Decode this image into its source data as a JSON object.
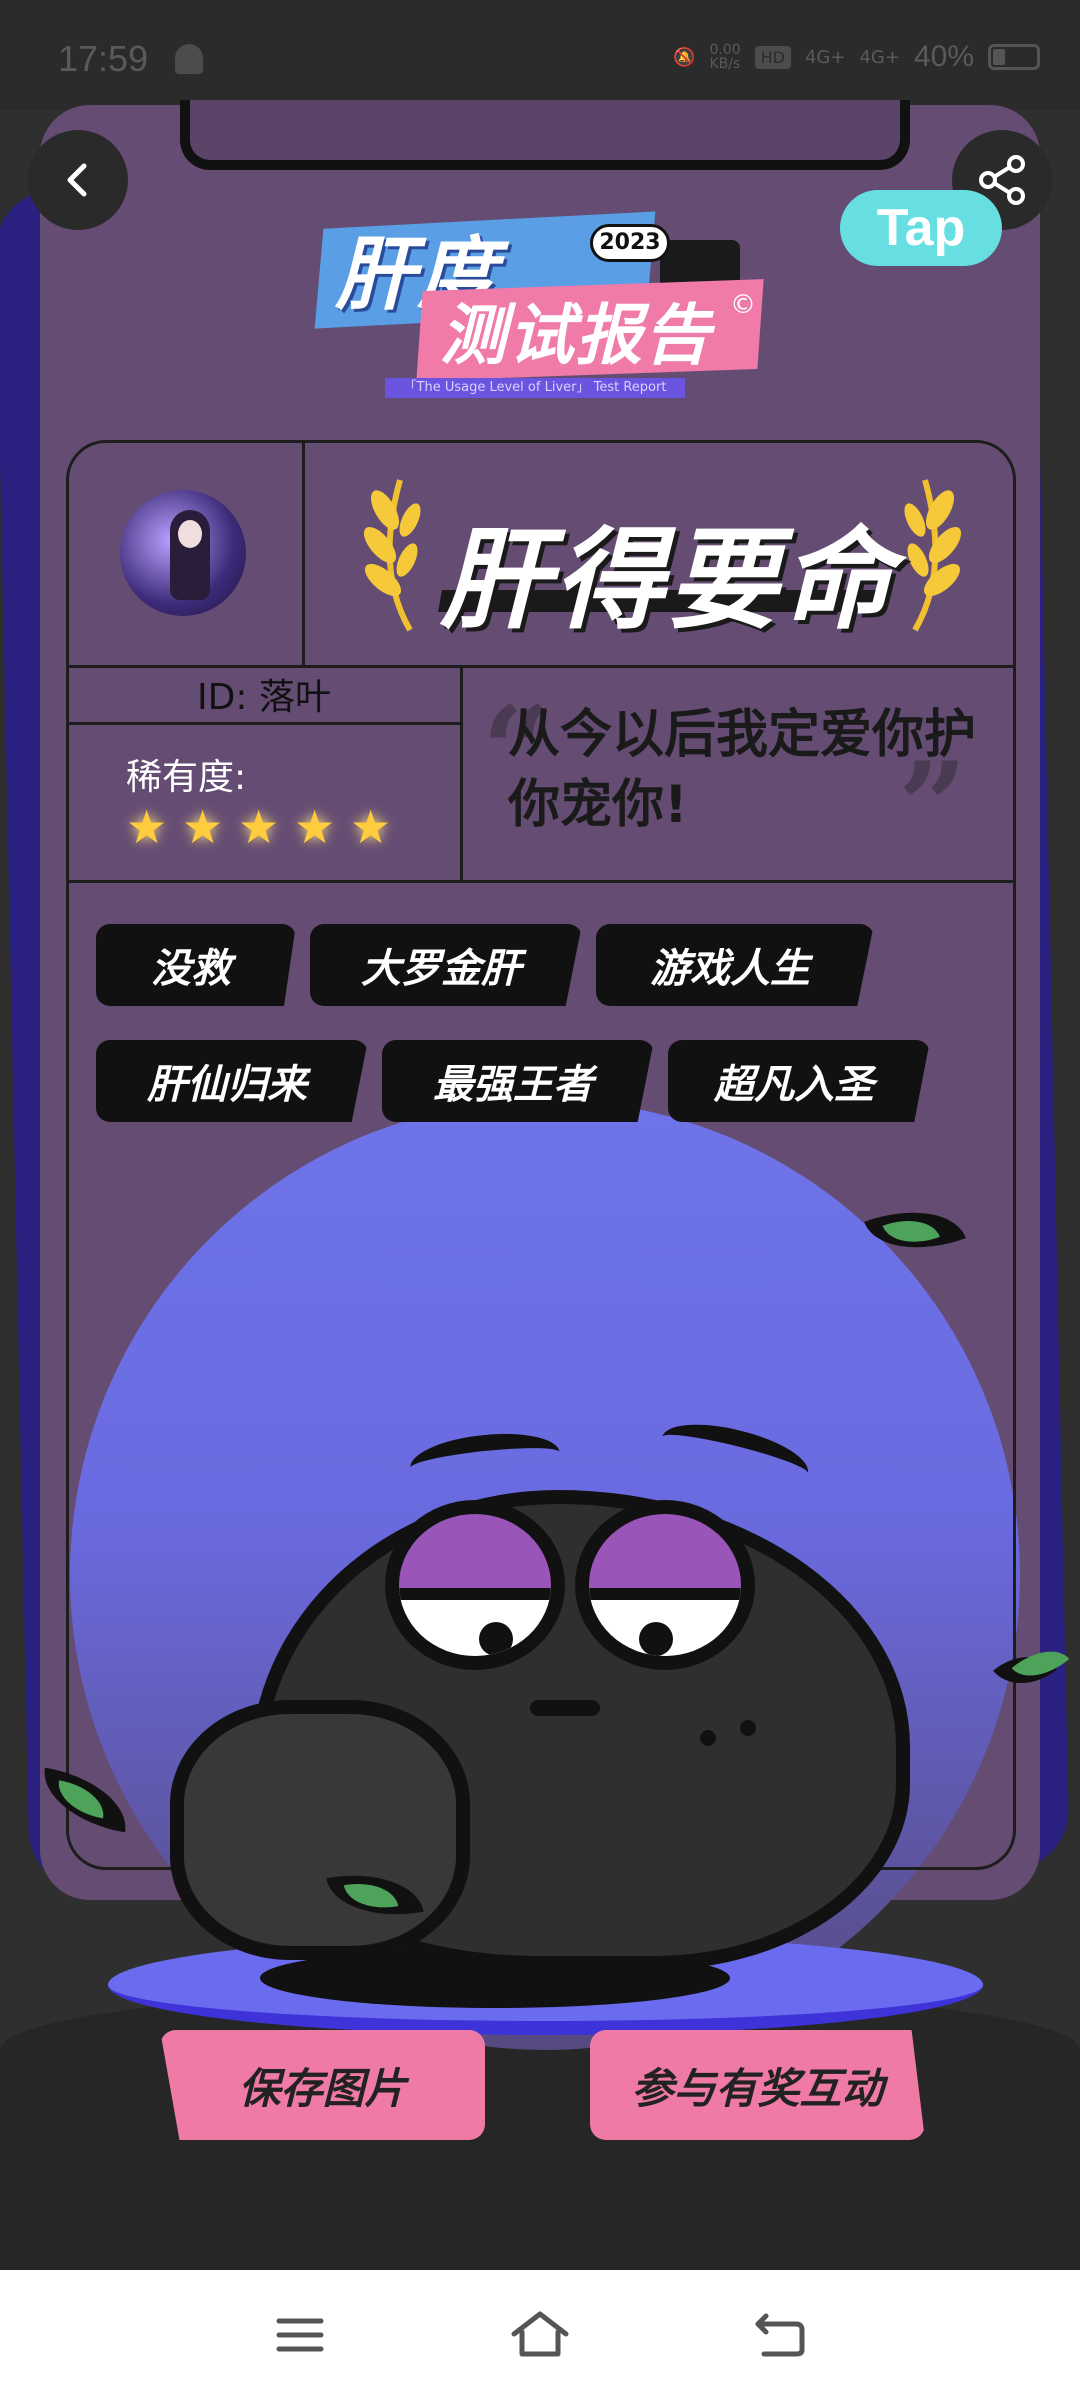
{
  "status_bar": {
    "time": "17:59",
    "net_speed_top": "0.00",
    "net_speed_unit": "KB/s",
    "hd_tag": "HD",
    "signal_1": "4G+",
    "signal_2": "4G+",
    "battery_text": "40%"
  },
  "header": {
    "back_icon": "chevron-left-icon",
    "share_icon": "share-icon",
    "tap_badge": "Tap"
  },
  "logo": {
    "line1": "肝度",
    "year": "2023",
    "line2": "测试报告",
    "copyright": "©",
    "subtitle": "「The Usage Level of Liver」 Test Report"
  },
  "report": {
    "title": "肝得要命",
    "user_id": "ID: 落叶",
    "rarity_label": "稀有度:",
    "rarity_stars": 5,
    "quote": "从今以后我定爱你护你宠你!",
    "tags_row1": [
      "没救",
      "大罗金肝",
      "游戏人生"
    ],
    "tags_row2": [
      "肝仙归来",
      "最强王者",
      "超凡入圣"
    ]
  },
  "actions": {
    "save_label": "保存图片",
    "join_label": "参与有奖互动"
  },
  "nav": {
    "menu_icon": "menu-icon",
    "home_icon": "home-icon",
    "back_icon": "back-icon"
  },
  "colors": {
    "card": "#654c73",
    "accent_pink": "#ef7aa6",
    "accent_cyan": "#67dfe2",
    "sphere": "#6e74e9",
    "star": "#ffcc3d"
  }
}
